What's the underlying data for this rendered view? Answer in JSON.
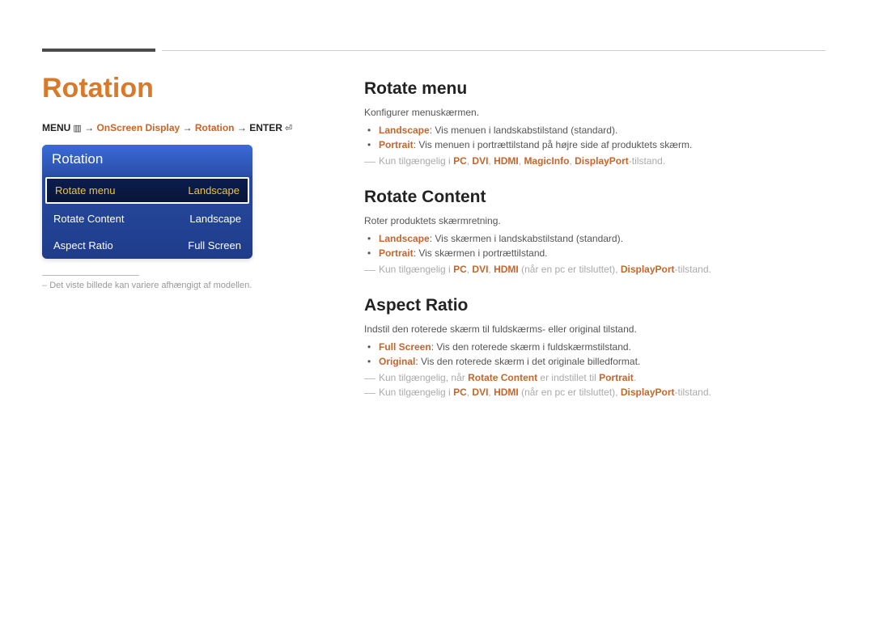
{
  "main_title": "Rotation",
  "breadcrumb": {
    "menu": "MENU",
    "arrow": " → ",
    "onscreen": "OnScreen Display",
    "rotation": "Rotation",
    "enter": "ENTER"
  },
  "osd": {
    "header": "Rotation",
    "rows": [
      {
        "label": "Rotate menu",
        "value": "Landscape",
        "selected": true
      },
      {
        "label": "Rotate Content",
        "value": "Landscape",
        "selected": false
      },
      {
        "label": "Aspect Ratio",
        "value": "Full Screen",
        "selected": false
      }
    ]
  },
  "footnote": "Det viste billede kan variere afhængigt af modellen.",
  "sections": {
    "rotate_menu": {
      "title": "Rotate menu",
      "desc": "Konfigurer menuskærmen.",
      "b1_key": "Landscape",
      "b1_text": ": Vis menuen i landskabstilstand (standard).",
      "b2_key": "Portrait",
      "b2_text": ": Vis menuen i portrættilstand på højre side af produktets skærm.",
      "note_pre": "Kun tilgængelig i ",
      "note_pc": "PC",
      "note_dvi": "DVI",
      "note_hdmi": "HDMI",
      "note_magic": "MagicInfo",
      "note_dp": "DisplayPort",
      "note_post": "-tilstand."
    },
    "rotate_content": {
      "title": "Rotate Content",
      "desc": "Roter produktets skærmretning.",
      "b1_key": "Landscape",
      "b1_text": ": Vis skærmen i landskabstilstand (standard).",
      "b2_key": "Portrait",
      "b2_text": ": Vis skærmen i portrættilstand.",
      "note_pre": "Kun tilgængelig i ",
      "note_pc": "PC",
      "note_dvi": "DVI",
      "note_hdmi": "HDMI",
      "note_mid": " (når en pc er tilsluttet), ",
      "note_dp": "DisplayPort",
      "note_post": "-tilstand."
    },
    "aspect_ratio": {
      "title": "Aspect Ratio",
      "desc": "Indstil den roterede skærm til fuldskærms- eller original tilstand.",
      "b1_key": "Full Screen",
      "b1_text": ": Vis den roterede skærm i fuldskærmstilstand.",
      "b2_key": "Original",
      "b2_text": ": Vis den roterede skærm i det originale billedformat.",
      "note1_pre": "Kun tilgængelig, når ",
      "note1_rc": "Rotate Content",
      "note1_mid": " er indstillet til ",
      "note1_portrait": "Portrait",
      "note1_post": ".",
      "note2_pre": "Kun tilgængelig i ",
      "note2_pc": "PC",
      "note2_dvi": "DVI",
      "note2_hdmi": "HDMI",
      "note2_mid": " (når en pc er tilsluttet), ",
      "note2_dp": "DisplayPort",
      "note2_post": "-tilstand."
    }
  }
}
